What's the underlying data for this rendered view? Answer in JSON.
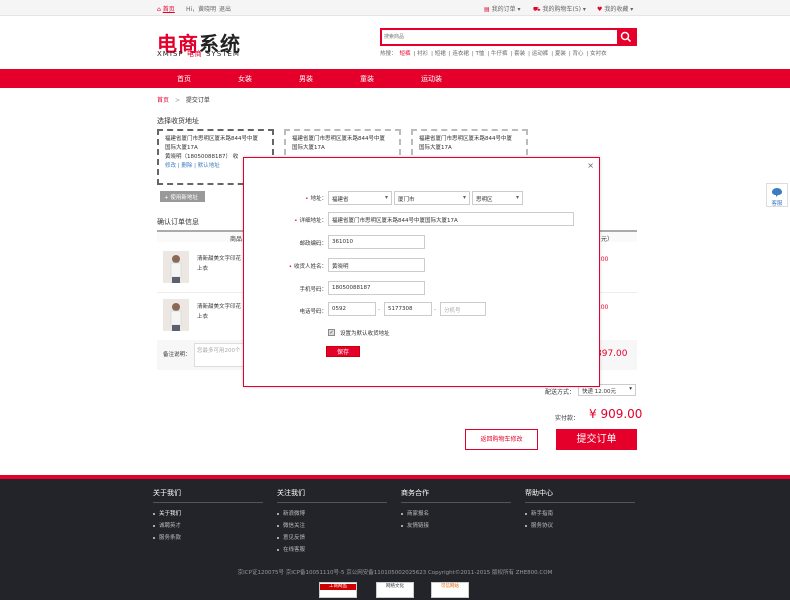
{
  "topbar": {
    "home": "首页",
    "greeting": "Hi，黄晓明",
    "logout": "退出",
    "my_orders": "我的订单",
    "cart": "我的购物车(5)",
    "favorites": "我的收藏"
  },
  "header": {
    "logo_cn_a": "电商",
    "logo_cn_b": "系统",
    "logo_en_a": "XMISP",
    "logo_en_b": "电商",
    "logo_en_c": "SYSTEM",
    "search_placeholder": "搜索商品",
    "hot_label": "热搜：",
    "hot_links": [
      "短裤",
      "衬衫",
      "短裙",
      "连衣裙",
      "T恤",
      "牛仔裤",
      "套装",
      "运动裤",
      "夏装",
      "背心",
      "女衬衣"
    ]
  },
  "nav": [
    "首页",
    "女装",
    "男装",
    "童装",
    "运动装"
  ],
  "breadcrumb": {
    "home": "首页",
    "sep": ">",
    "current": "提交订单"
  },
  "address": {
    "section_title": "选择收货地址",
    "cards": [
      {
        "line1": "福建省厦门市思明区厦禾路844号中厦",
        "line2": "国际大厦17A",
        "line3": "黄晓明（18050088187） 收",
        "actions": "修改 | 删除 | 默认地址"
      },
      {
        "line1": "福建省厦门市思明区厦禾路844号中厦",
        "line2": "国际大厦17A"
      },
      {
        "line1": "福建省厦门市思明区厦禾路844号中厦",
        "line2": "国际大厦17A"
      }
    ],
    "add_button": "使用新地址"
  },
  "confirm": {
    "section_title": "确认订单信息",
    "head_product": "商品",
    "head_right": "元）",
    "products": [
      {
        "name": "清新甜美文字印花 松上衣",
        "price": "9.00"
      },
      {
        "name": "清新甜美文字印花 松上衣",
        "price": "9.00"
      }
    ],
    "remark_label": "备注说明：",
    "remark_placeholder": "您最多可用200个",
    "subtotal": "897.00",
    "shipping_label": "配送方式：",
    "shipping_value": "快递 12.00元",
    "pay_label": "实付款：",
    "pay_value": "¥ 909.00",
    "back_button": "返回购物车修改",
    "submit_button": "提交订单"
  },
  "modal": {
    "close": "×",
    "address_label": "地址：",
    "province": "福建省",
    "city": "厦门市",
    "district": "思明区",
    "detail_label": "详细地址：",
    "detail_value": "福建省厦门市思明区厦禾路844号中厦国际大厦17A",
    "zip_label": "邮政编码：",
    "zip_value": "361010",
    "name_label": "收货人姓名：",
    "name_value": "黄晓明",
    "mobile_label": "手机号码：",
    "mobile_value": "18050088187",
    "phone_label": "电话号码：",
    "phone_area": "0592",
    "phone_dash": "-",
    "phone_number": "5177308",
    "phone_ext_placeholder": "分机号",
    "default_label": "设置为默认收货地址",
    "save_button": "保存"
  },
  "side": {
    "help": "客服"
  },
  "footer": {
    "columns": [
      {
        "title": "关于我们",
        "items": [
          "关于我们",
          "诚聘英才",
          "服务条款"
        ]
      },
      {
        "title": "关注我们",
        "items": [
          "新浪微博",
          "微信关注",
          "意见反馈",
          "在线客服"
        ]
      },
      {
        "title": "商务合作",
        "items": [
          "商家报名",
          "友情链接"
        ]
      },
      {
        "title": "帮助中心",
        "items": [
          "新手指南",
          "服务协议"
        ]
      }
    ],
    "copyright": "京ICP证120075号  京ICP备10051110号-5  京公网安备110105002025623  Copyright©2011-2015  版权所有 ZHE800.COM",
    "badges": [
      "工商网监",
      "网络文化",
      "可信网站"
    ]
  },
  "colors": {
    "accent": "#e4002b",
    "footer_bg": "#23242a"
  }
}
